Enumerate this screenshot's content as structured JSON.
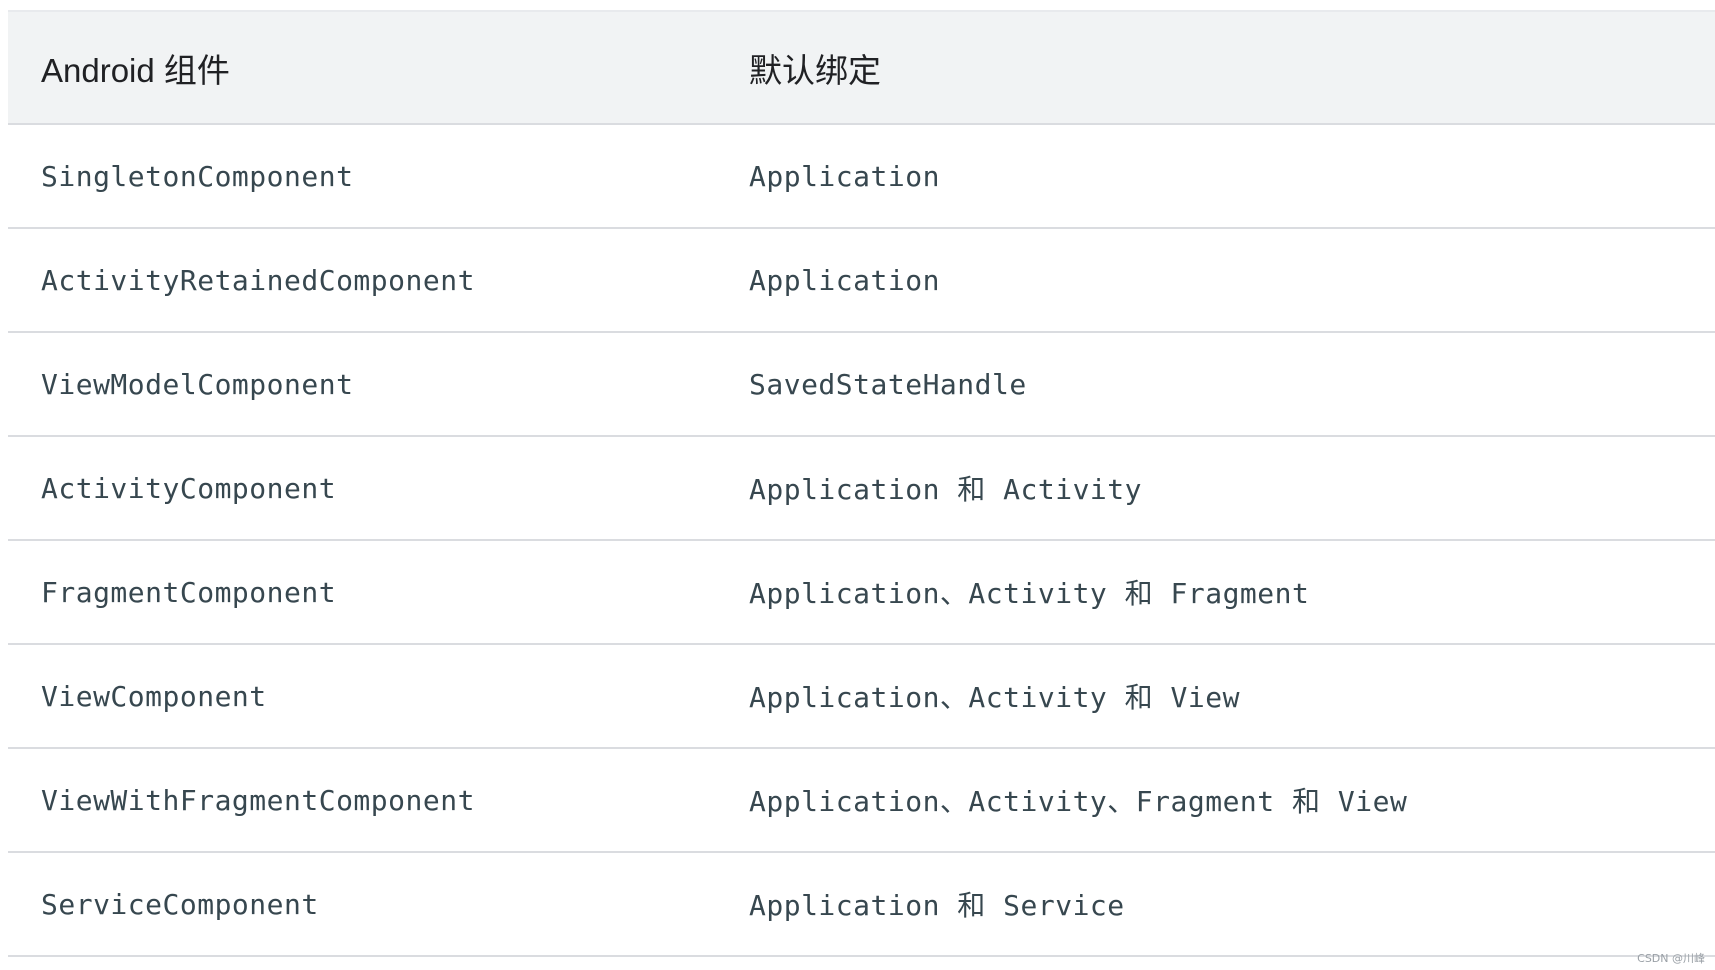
{
  "table": {
    "headers": [
      "Android 组件",
      "默认绑定"
    ],
    "rows": [
      {
        "component": "SingletonComponent",
        "binding": "Application"
      },
      {
        "component": "ActivityRetainedComponent",
        "binding": "Application"
      },
      {
        "component": "ViewModelComponent",
        "binding": "SavedStateHandle"
      },
      {
        "component": "ActivityComponent",
        "binding": "Application 和 Activity"
      },
      {
        "component": "FragmentComponent",
        "binding": "Application、Activity 和 Fragment"
      },
      {
        "component": "ViewComponent",
        "binding": "Application、Activity 和 View"
      },
      {
        "component": "ViewWithFragmentComponent",
        "binding": "Application、Activity、Fragment 和 View"
      },
      {
        "component": "ServiceComponent",
        "binding": "Application 和 Service"
      }
    ]
  },
  "watermark": "CSDN @川峰",
  "colors": {
    "header_bg": "#f1f3f4",
    "divider": "#dadce0",
    "code_text": "#37474f",
    "header_text": "#202124"
  }
}
